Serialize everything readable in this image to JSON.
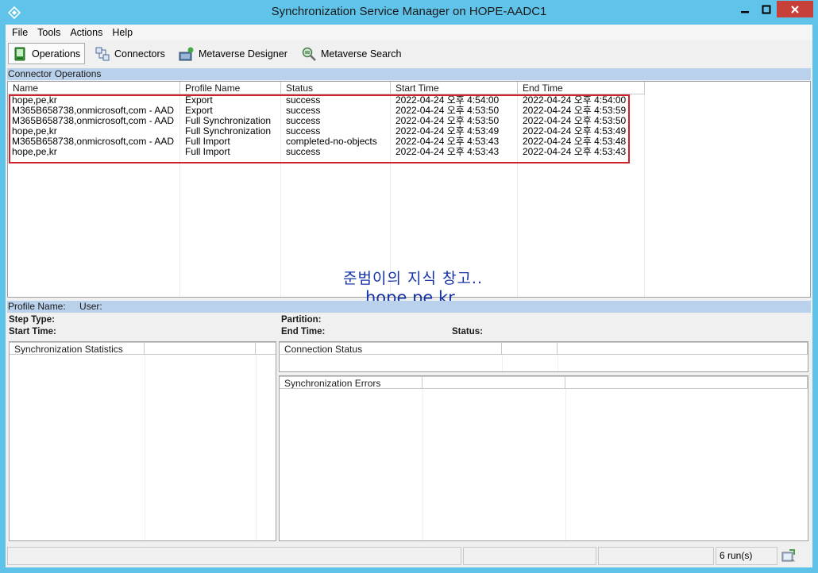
{
  "window": {
    "title": "Synchronization Service Manager on HOPE-AADC1",
    "accent_color": "#60c3e9",
    "close_color": "#c7403a"
  },
  "menu": {
    "items": [
      {
        "label": "File"
      },
      {
        "label": "Tools"
      },
      {
        "label": "Actions"
      },
      {
        "label": "Help"
      }
    ]
  },
  "toolbar": {
    "items": [
      {
        "label": "Operations",
        "icon": "operations-icon",
        "selected": true
      },
      {
        "label": "Connectors",
        "icon": "connectors-icon"
      },
      {
        "label": "Metaverse Designer",
        "icon": "metaverse-designer-icon"
      },
      {
        "label": "Metaverse Search",
        "icon": "metaverse-search-icon"
      }
    ]
  },
  "connector_operations": {
    "header": "Connector Operations",
    "columns": [
      "Name",
      "Profile Name",
      "Status",
      "Start Time",
      "End Time"
    ],
    "rows": [
      {
        "name": "hope,pe,kr",
        "profile": "Export",
        "status": "success",
        "start": "2022-04-24 오후 4:54:00",
        "end": "2022-04-24 오후 4:54:00"
      },
      {
        "name": "M365B658738,onmicrosoft,com - AAD",
        "profile": "Export",
        "status": "success",
        "start": "2022-04-24 오후 4:53:50",
        "end": "2022-04-24 오후 4:53:59"
      },
      {
        "name": "M365B658738,onmicrosoft,com - AAD",
        "profile": "Full Synchronization",
        "status": "success",
        "start": "2022-04-24 오후 4:53:50",
        "end": "2022-04-24 오후 4:53:50"
      },
      {
        "name": "hope,pe,kr",
        "profile": "Full Synchronization",
        "status": "success",
        "start": "2022-04-24 오후 4:53:49",
        "end": "2022-04-24 오후 4:53:49"
      },
      {
        "name": "M365B658738,onmicrosoft,com - AAD",
        "profile": "Full Import",
        "status": "completed-no-objects",
        "start": "2022-04-24 오후 4:53:43",
        "end": "2022-04-24 오후 4:53:48"
      },
      {
        "name": "hope,pe,kr",
        "profile": "Full Import",
        "status": "success",
        "start": "2022-04-24 오후 4:53:43",
        "end": "2022-04-24 오후 4:53:43"
      }
    ],
    "highlight_color": "#d0202a"
  },
  "watermark": {
    "korean": "준범이의 지식 창고..",
    "url": "hope.pe.kr",
    "color": "#1433a8"
  },
  "details": {
    "profile_name_label": "Profile Name:",
    "user_label": "User:",
    "step_type_label": "Step Type:",
    "start_time_label": "Start Time:",
    "partition_label": "Partition:",
    "end_time_label": "End Time:",
    "status_label": "Status:"
  },
  "sync_statistics": {
    "header": "Synchronization Statistics"
  },
  "connection_status": {
    "header": "Connection Status"
  },
  "sync_errors": {
    "header": "Synchronization Errors"
  },
  "statusbar": {
    "runs": "6 run(s)"
  }
}
